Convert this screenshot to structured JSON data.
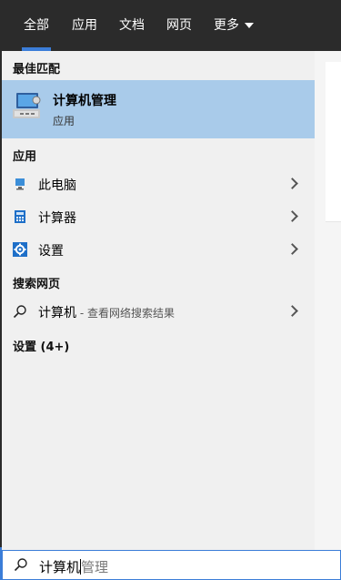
{
  "tabs": [
    {
      "label": "全部",
      "active": true
    },
    {
      "label": "应用",
      "active": false
    },
    {
      "label": "文档",
      "active": false
    },
    {
      "label": "网页",
      "active": false
    },
    {
      "label": "更多",
      "active": false
    }
  ],
  "best_match": {
    "header": "最佳匹配",
    "title": "计算机管理",
    "subtitle": "应用",
    "icon": "computer-management-icon"
  },
  "apps": {
    "header": "应用",
    "items": [
      {
        "label": "此电脑",
        "icon": "this-pc-icon"
      },
      {
        "label": "计算器",
        "icon": "calculator-icon"
      },
      {
        "label": "设置",
        "icon": "settings-gear-icon"
      }
    ]
  },
  "web": {
    "header": "搜索网页",
    "query": "计算机",
    "suffix": " - 查看网络搜索结果"
  },
  "settings_header": "设置 (4+)",
  "search": {
    "typed": "计算机",
    "autocomplete": "管理"
  },
  "colors": {
    "accent": "#3b7dd8",
    "selection": "#a9cbea",
    "tabbar": "#2b2b2b"
  }
}
